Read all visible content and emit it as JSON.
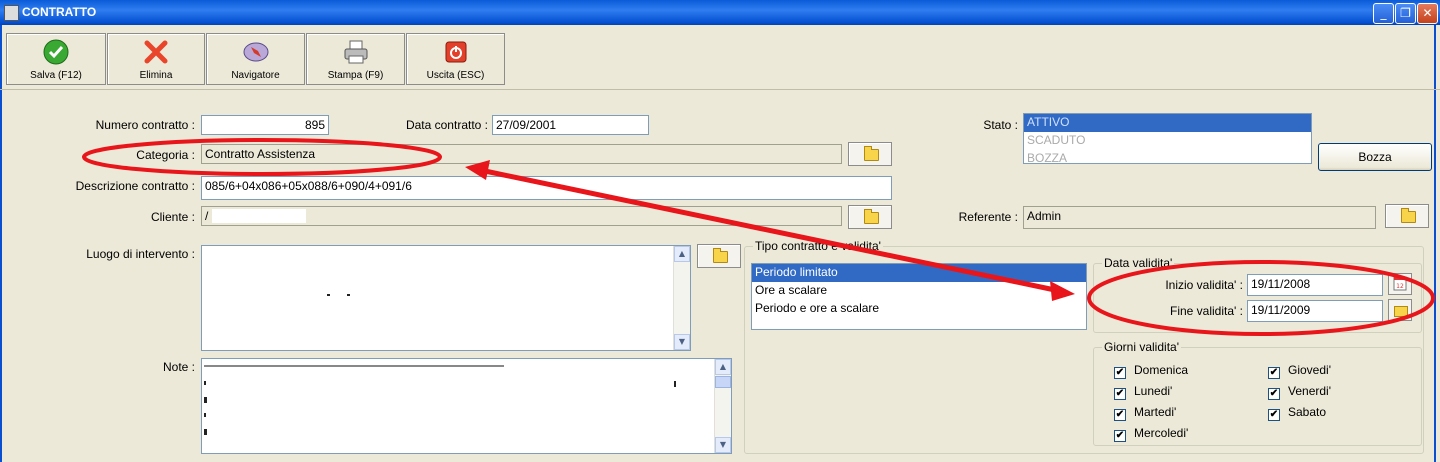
{
  "window": {
    "title": "CONTRATTO",
    "minimize": "_",
    "restore": "❐",
    "close": "✕"
  },
  "toolbar": {
    "save": "Salva (F12)",
    "delete": "Elimina",
    "navigator": "Navigatore",
    "print": "Stampa (F9)",
    "exit": "Uscita (ESC)"
  },
  "form": {
    "numero_label": "Numero contratto :",
    "numero_value": "895",
    "data_label": "Data contratto :",
    "data_value": "27/09/2001",
    "categoria_label": "Categoria :",
    "categoria_value": "Contratto Assistenza",
    "descrizione_label": "Descrizione contratto :",
    "descrizione_value": "085/6+04x086+05x088/6+090/4+091/6",
    "cliente_label": "Cliente :",
    "cliente_value": "/",
    "luogo_label": "Luogo di intervento :",
    "note_label": "Note :",
    "stato_label": "Stato :",
    "stato_options": [
      "ATTIVO",
      "SCADUTO",
      "BOZZA"
    ],
    "bozza_button": "Bozza",
    "referente_label": "Referente :",
    "referente_value": "Admin"
  },
  "tipo": {
    "title": "Tipo contratto e validita'",
    "options": [
      "Periodo limitato",
      "Ore a scalare",
      "Periodo e ore a scalare"
    ]
  },
  "validita": {
    "title": "Data validita'",
    "inizio_label": "Inizio validita' :",
    "inizio_value": "19/11/2008",
    "fine_label": "Fine validita' :",
    "fine_value": "19/11/2009"
  },
  "giorni": {
    "title": "Giorni validita'",
    "days": [
      "Domenica",
      "Lunedi'",
      "Martedi'",
      "Mercoledi'",
      "Giovedi'",
      "Venerdi'",
      "Sabato"
    ],
    "check": "✔"
  },
  "colors": {
    "annotation": "#e8161b",
    "selection": "#316ac5",
    "titlebar": "#0a5bd9"
  }
}
